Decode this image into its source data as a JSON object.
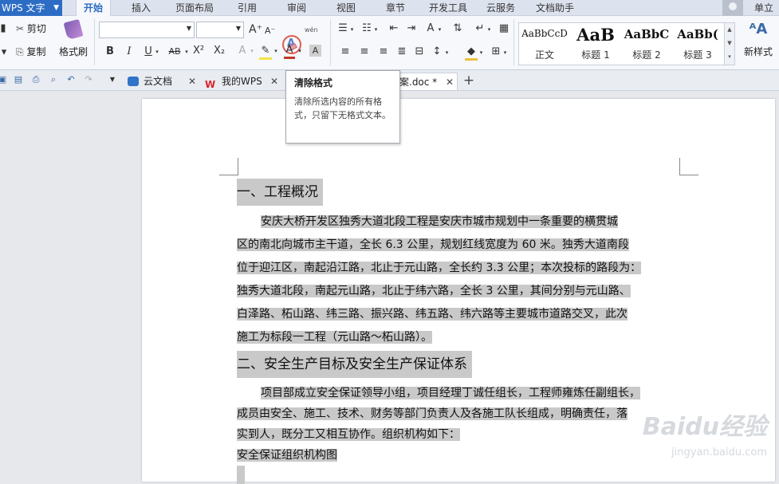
{
  "app": {
    "name": "WPS 文字"
  },
  "menu": {
    "tabs": [
      "开始",
      "插入",
      "页面布局",
      "引用",
      "审阅",
      "视图",
      "章节",
      "开发工具",
      "云服务",
      "文档助手"
    ],
    "active_tab": "开始",
    "user": "单立"
  },
  "ribbon": {
    "clipboard": {
      "cut": "剪切",
      "copy": "复制",
      "format_painter": "格式刷"
    },
    "font_name": "",
    "font_size": "",
    "styles": [
      {
        "preview": "AaBbCcD",
        "name": "正文"
      },
      {
        "preview": "AaB",
        "name": "标题 1"
      },
      {
        "preview": "AaBbC",
        "name": "标题 2"
      },
      {
        "preview": "AaBb(",
        "name": "标题 3"
      }
    ],
    "new_style": "新样式"
  },
  "tabs": {
    "items": [
      {
        "label": "云文档"
      },
      {
        "label": "我的WPS"
      },
      {
        "label": "案.doc *"
      }
    ]
  },
  "tooltip": {
    "title": "清除格式",
    "description": "清除所选内容的所有格式，只留下无格式文本。"
  },
  "document": {
    "heading1": "一、工程概况",
    "para1_lines": [
      "安庆大桥开发区独秀大道北段工程是安庆市城市规划中一条重要的横贯城",
      "区的南北向城市主干道，全长 6.3 公里，规划红线宽度为 60 米。独秀大道南段",
      "位于迎江区，南起沿江路，北止于元山路，全长约 3.3 公里；本次投标的路段为：",
      "独秀大道北段，南起元山路，北止于纬六路，全长 3 公里，其间分别与元山路、",
      "白泽路、柘山路、纬三路、振兴路、纬五路、纬六路等主要城市道路交叉，此次",
      "施工为标段一工程（元山路～柘山路）。"
    ],
    "heading2": "二、安全生产目标及安全生产保证体系",
    "para2_lines": [
      "项目部成立安全保证领导小组，项目经理丁诚任组长，工程师雍炼任副组长，",
      "成员由安全、施工、技术、财务等部门负责人及各施工队长组成，明确责任，落",
      "实到人，既分工又相互协作。组织机构如下："
    ],
    "line_last": "安全保证组织机构图"
  },
  "watermark": {
    "brand": "Baidu经验",
    "url": "jingyan.baidu.com"
  }
}
